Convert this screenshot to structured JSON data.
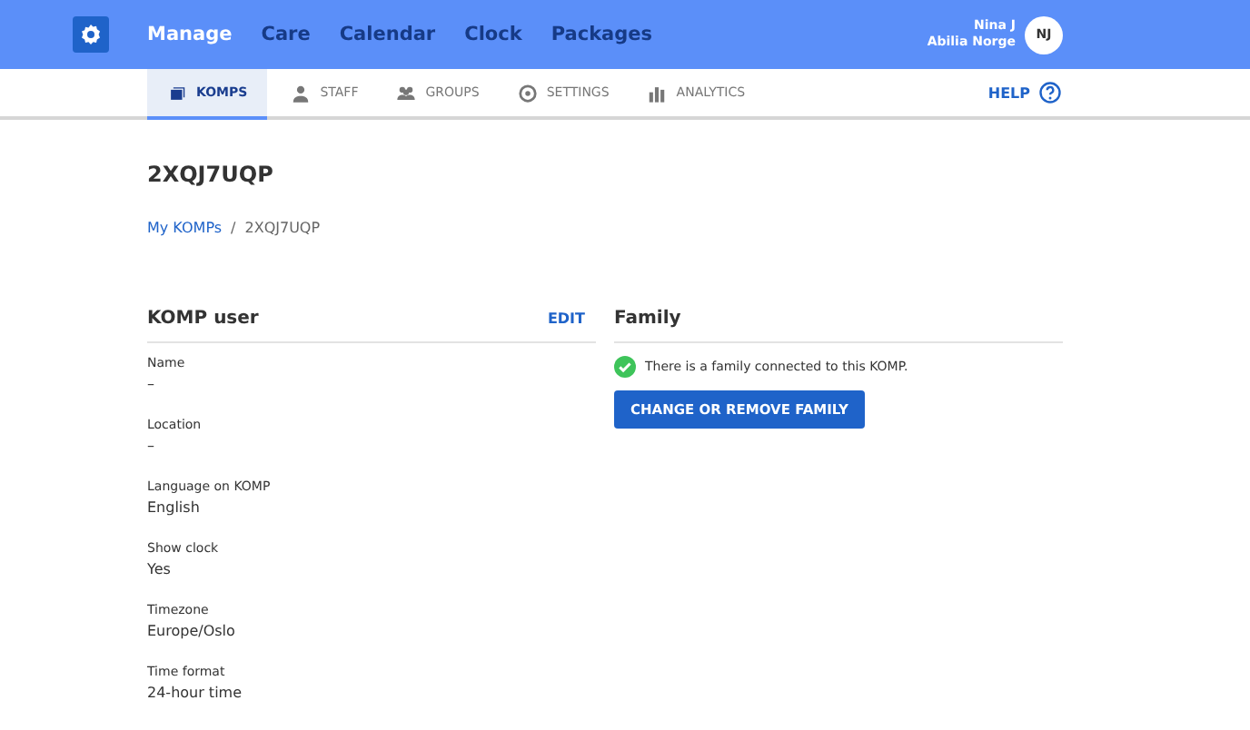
{
  "header": {
    "nav": [
      {
        "label": "Manage",
        "selected": true
      },
      {
        "label": "Care",
        "selected": false
      },
      {
        "label": "Calendar",
        "selected": false
      },
      {
        "label": "Clock",
        "selected": false
      },
      {
        "label": "Packages",
        "selected": false
      }
    ],
    "user": {
      "name": "Nina J",
      "org": "Abilia Norge",
      "initials": "NJ"
    }
  },
  "tabs": [
    {
      "label": "KOMPS",
      "selected": true
    },
    {
      "label": "STAFF",
      "selected": false
    },
    {
      "label": "GROUPS",
      "selected": false
    },
    {
      "label": "SETTINGS",
      "selected": false
    },
    {
      "label": "ANALYTICS",
      "selected": false
    }
  ],
  "help": "HELP",
  "page_title": "2XQJ7UQP",
  "breadcrumb": {
    "link": "My KOMPs",
    "separator": "/",
    "current": "2XQJ7UQP"
  },
  "user_panel": {
    "title": "KOMP user",
    "edit": "EDIT",
    "fields": [
      {
        "label": "Name",
        "value": "–"
      },
      {
        "label": "Location",
        "value": "–"
      },
      {
        "label": "Language on KOMP",
        "value": "English"
      },
      {
        "label": "Show clock",
        "value": "Yes"
      },
      {
        "label": "Timezone",
        "value": "Europe/Oslo"
      },
      {
        "label": "Time format",
        "value": "24-hour time"
      }
    ]
  },
  "family_panel": {
    "title": "Family",
    "connected": true,
    "message": "There is a family connected to this KOMP.",
    "button": "CHANGE OR REMOVE FAMILY"
  }
}
